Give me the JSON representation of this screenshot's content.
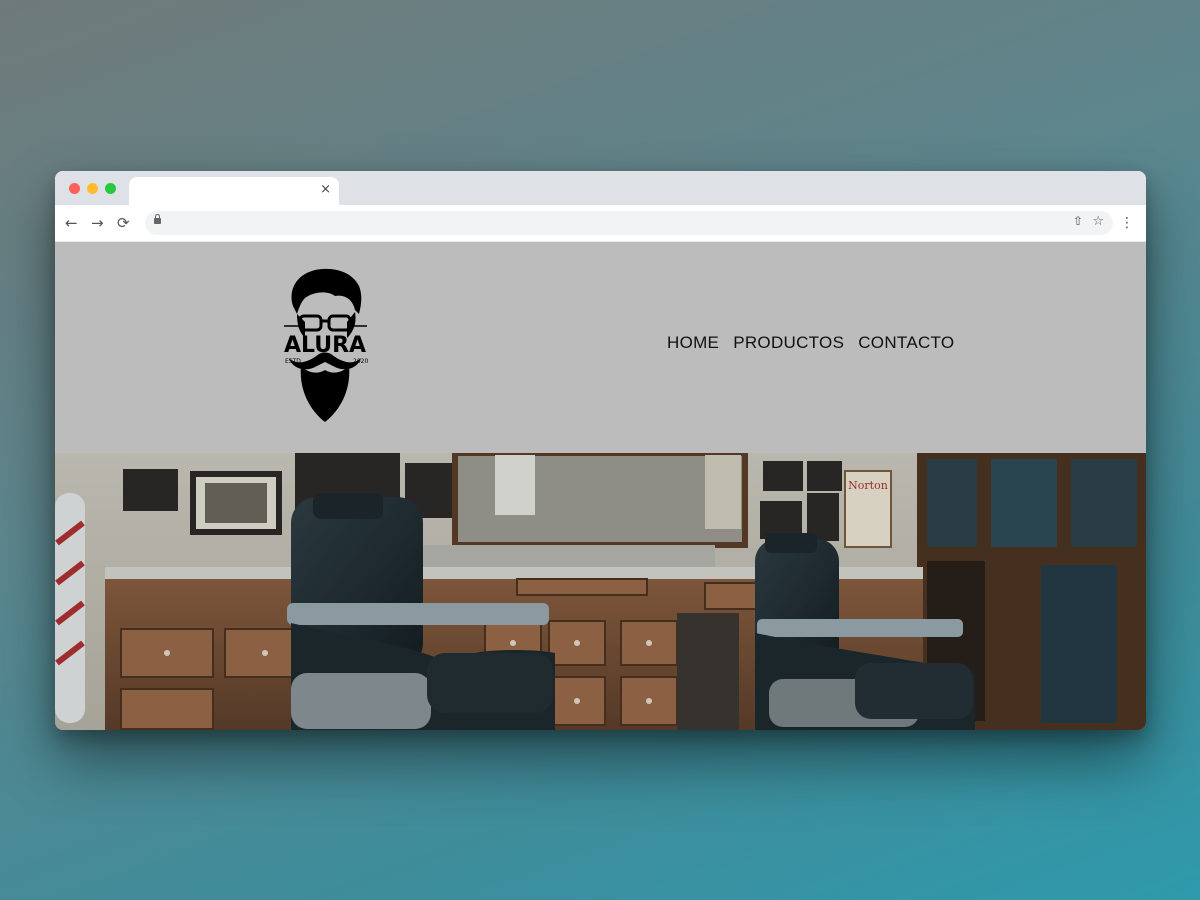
{
  "browser": {
    "tab_close_icon": "×",
    "back_icon": "←",
    "forward_icon": "→",
    "reload_icon": "⟳",
    "menu_icon": "⋮",
    "share_icon": "⇧",
    "star_icon": "☆"
  },
  "site": {
    "logo": {
      "brand": "ALURA",
      "left_text": "ESTD",
      "right_text": "2020"
    },
    "nav": [
      {
        "label": "HOME"
      },
      {
        "label": "PRODUCTOS"
      },
      {
        "label": "CONTACTO"
      }
    ],
    "hero": {
      "description": "Barbershop interior",
      "sign_text": "Norton"
    }
  },
  "colors": {
    "header_bg": "#bcbcbc",
    "nav_text": "#111111",
    "backdrop_start": "#6f7a7a",
    "backdrop_end": "#2e9aac"
  }
}
